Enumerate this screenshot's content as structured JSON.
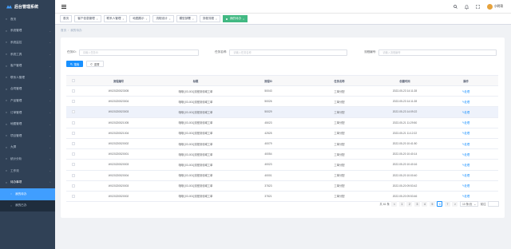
{
  "brand": {
    "title": "后台管理系统"
  },
  "sidebar": {
    "items": [
      {
        "label": "首页",
        "icon": "home-icon",
        "chevron": false
      },
      {
        "label": "系统管理",
        "icon": "gear-icon",
        "chevron": true
      },
      {
        "label": "系统监控",
        "icon": "monitor-icon",
        "chevron": true
      },
      {
        "label": "系统工具",
        "icon": "tool-icon",
        "chevron": true
      },
      {
        "label": "客户管理",
        "icon": "user-icon",
        "chevron": true
      },
      {
        "label": "联系人管理",
        "icon": "contact-icon",
        "chevron": true
      },
      {
        "label": "合同管理",
        "icon": "contract-icon",
        "chevron": true
      },
      {
        "label": "产品管理",
        "icon": "product-icon",
        "chevron": true
      },
      {
        "label": "订单管理",
        "icon": "order-icon",
        "chevron": true
      },
      {
        "label": "地图管理",
        "icon": "map-icon",
        "chevron": true
      },
      {
        "label": "项目管理",
        "icon": "project-icon",
        "chevron": true
      },
      {
        "label": "大屏",
        "icon": "screen-icon",
        "chevron": true
      },
      {
        "label": "统计分析",
        "icon": "chart-icon",
        "chevron": true
      },
      {
        "label": "工作流",
        "icon": "flow-icon",
        "chevron": true
      },
      {
        "label": "待办事项",
        "icon": "todo-icon",
        "chevron": true,
        "open": true
      }
    ],
    "subitems": [
      {
        "label": "我的待办",
        "icon": "todo-list-icon",
        "active": true
      },
      {
        "label": "我的已办",
        "icon": "done-list-icon",
        "active": false
      }
    ]
  },
  "navbar": {
    "user_name": "小明哥"
  },
  "tags": [
    {
      "label": "首页",
      "closable": false,
      "active": false
    },
    {
      "label": "客户信息管理",
      "closable": true,
      "active": false
    },
    {
      "label": "联系人管理",
      "closable": true,
      "active": false
    },
    {
      "label": "地图展示",
      "closable": true,
      "active": false
    },
    {
      "label": "流程设计",
      "closable": true,
      "active": false
    },
    {
      "label": "模型部署",
      "closable": true,
      "active": false
    },
    {
      "label": "流程流程",
      "closable": true,
      "active": false
    },
    {
      "label": "我的待办",
      "closable": true,
      "active": true
    }
  ],
  "breadcrumb": {
    "home": "首页",
    "separator": "/",
    "current": "我的待办"
  },
  "search": {
    "fields": [
      {
        "label": "任务ID:",
        "placeholder": "请输入任务ID"
      },
      {
        "label": "任务名称:",
        "placeholder": "请输入任务名称"
      },
      {
        "label": "流程编号:",
        "placeholder": "请输入流程编号"
      }
    ],
    "search_label": "搜索",
    "reset_label": "重置"
  },
  "table": {
    "headers": [
      "流程编号",
      "标题",
      "流程ID",
      "任务名称",
      "创建时间",
      "操作"
    ],
    "rows": [
      [
        "WX20220523005",
        "哦哦 [03-001]流程到领域工单",
        "50043",
        "工单分配",
        "2022-05-23 14:11:28",
        "处理"
      ],
      [
        "WX20220523004",
        "哦哦 [03-001]流程到领域工单",
        "50026",
        "工单分配",
        "2022-05-23 14:11:28",
        "处理"
      ],
      [
        "WX20220523003",
        "哦哦 [03-001]流程到领域工单",
        "50029",
        "工单分配",
        "2022-05-23 14:09:22",
        "处理"
      ],
      [
        "WX20220521005",
        "哦哦 [03-001]流程到领域工单",
        "45023",
        "工单分配",
        "2022-05-21 11:29:50",
        "处理"
      ],
      [
        "WX20220521004",
        "哦哦 [03-001]流程到领域工单",
        "42525",
        "工单分配",
        "2022-05-21 11:12:22",
        "处理"
      ],
      [
        "WX20220520002",
        "哦哦 [03-001]流程到领域工单",
        "40079",
        "工单分配",
        "2022-05-20 10:41:50",
        "处理"
      ],
      [
        "WX20220520001",
        "哦哦 [03-001]流程到领域工单",
        "40054",
        "工单分配",
        "2022-05-20 10:40:14",
        "处理"
      ],
      [
        "WX20220520003",
        "哦哦 [03-001]流程到领域工单",
        "40023",
        "工单分配",
        "2022-05-20 10:40:16",
        "处理"
      ],
      [
        "WX20220520004",
        "哦哦 [03-001]流程到领域工单",
        "40001",
        "工单分配",
        "2022-05-20 10:00:40",
        "处理"
      ],
      [
        "WX20220520003",
        "哦哦 [03-001]流程到领域工单",
        "37523",
        "工单分配",
        "2022-05-20 09:53:42",
        "处理"
      ],
      [
        "WX20220520002",
        "哦哦 [03-001]流程到领域工单",
        "37521",
        "工单分配",
        "2022-05-20 09:53:46",
        "处理"
      ]
    ],
    "hover_row": 2
  },
  "pagination": {
    "total_label": "共 61 条",
    "prev": "<",
    "pages": [
      "1",
      "2",
      "3",
      "4",
      "5",
      "6",
      "7"
    ],
    "active_page": "6",
    "next": ">",
    "page_size": "10 条/页",
    "goto_label": "前往"
  }
}
